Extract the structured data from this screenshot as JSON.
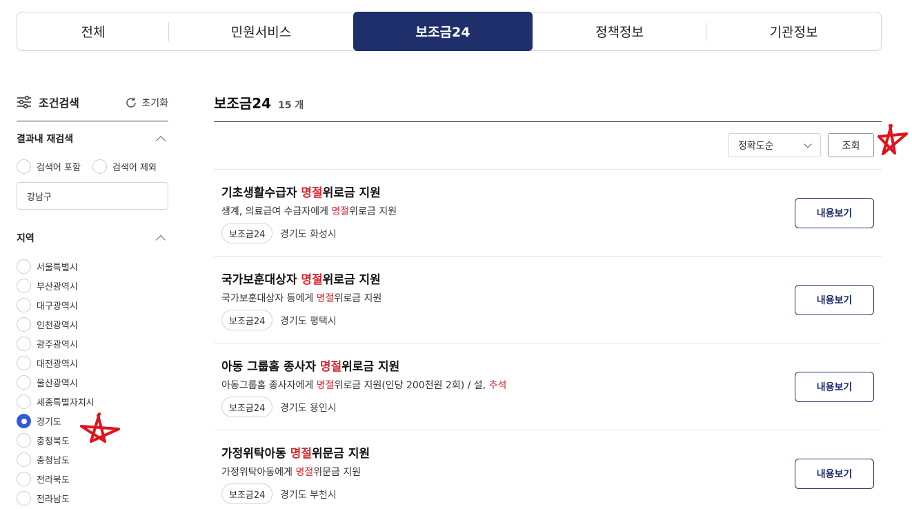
{
  "tabs": [
    "전체",
    "민원서비스",
    "보조금24",
    "정책정보",
    "기관정보"
  ],
  "active_tab_index": 2,
  "sidebar": {
    "title": "조건검색",
    "reset_label": "초기화",
    "research": {
      "heading": "결과내 재검색",
      "include_label": "검색어 포함",
      "exclude_label": "검색어 제외",
      "query_value": "강남구"
    },
    "region": {
      "heading": "지역",
      "items": [
        "서울특별시",
        "부산광역시",
        "대구광역시",
        "인천광역시",
        "광주광역시",
        "대전광역시",
        "울산광역시",
        "세종특별자치시",
        "경기도",
        "충청북도",
        "충청남도",
        "전라북도",
        "전라남도"
      ],
      "selected": "경기도"
    }
  },
  "main": {
    "title": "보조금24",
    "count": "15 개",
    "sort_value": "정확도순",
    "search_button": "조회",
    "view_button_label": "내용보기",
    "results": [
      {
        "title_pre": "기초생활수급자 ",
        "title_hl": "명절",
        "title_post": "위로금 지원",
        "desc_parts": [
          [
            "생계, 의료급여 수급자에게 ",
            false
          ],
          [
            "명절",
            true
          ],
          [
            "위로금 지원",
            false
          ]
        ],
        "tag": "보조금24",
        "location": "경기도 화성시"
      },
      {
        "title_pre": "국가보훈대상자 ",
        "title_hl": "명절",
        "title_post": "위로금 지원",
        "desc_parts": [
          [
            "국가보훈대상자 등에게 ",
            false
          ],
          [
            "명절",
            true
          ],
          [
            "위로금 지원",
            false
          ]
        ],
        "tag": "보조금24",
        "location": "경기도 평택시"
      },
      {
        "title_pre": "아동 그룹홈 종사자 ",
        "title_hl": "명절",
        "title_post": "위로금 지원",
        "desc_parts": [
          [
            "아동그룹홈 종사자에게 ",
            false
          ],
          [
            "명절",
            true
          ],
          [
            "위로금 지원(인당 200천원 2회) / 설, ",
            false
          ],
          [
            "추석",
            true
          ]
        ],
        "tag": "보조금24",
        "location": "경기도 용인시"
      },
      {
        "title_pre": "가정위탁아동 ",
        "title_hl": "명절",
        "title_post": "위문금 지원",
        "desc_parts": [
          [
            "가정위탁아동에게 ",
            false
          ],
          [
            "명절",
            true
          ],
          [
            "위문금 지원",
            false
          ]
        ],
        "tag": "보조금24",
        "location": "경기도 부천시"
      }
    ]
  },
  "colors": {
    "brand": "#1f2f6b",
    "highlight": "#d8282f",
    "radio_checked": "#2f5ad8",
    "annotation": "#e0141e"
  }
}
